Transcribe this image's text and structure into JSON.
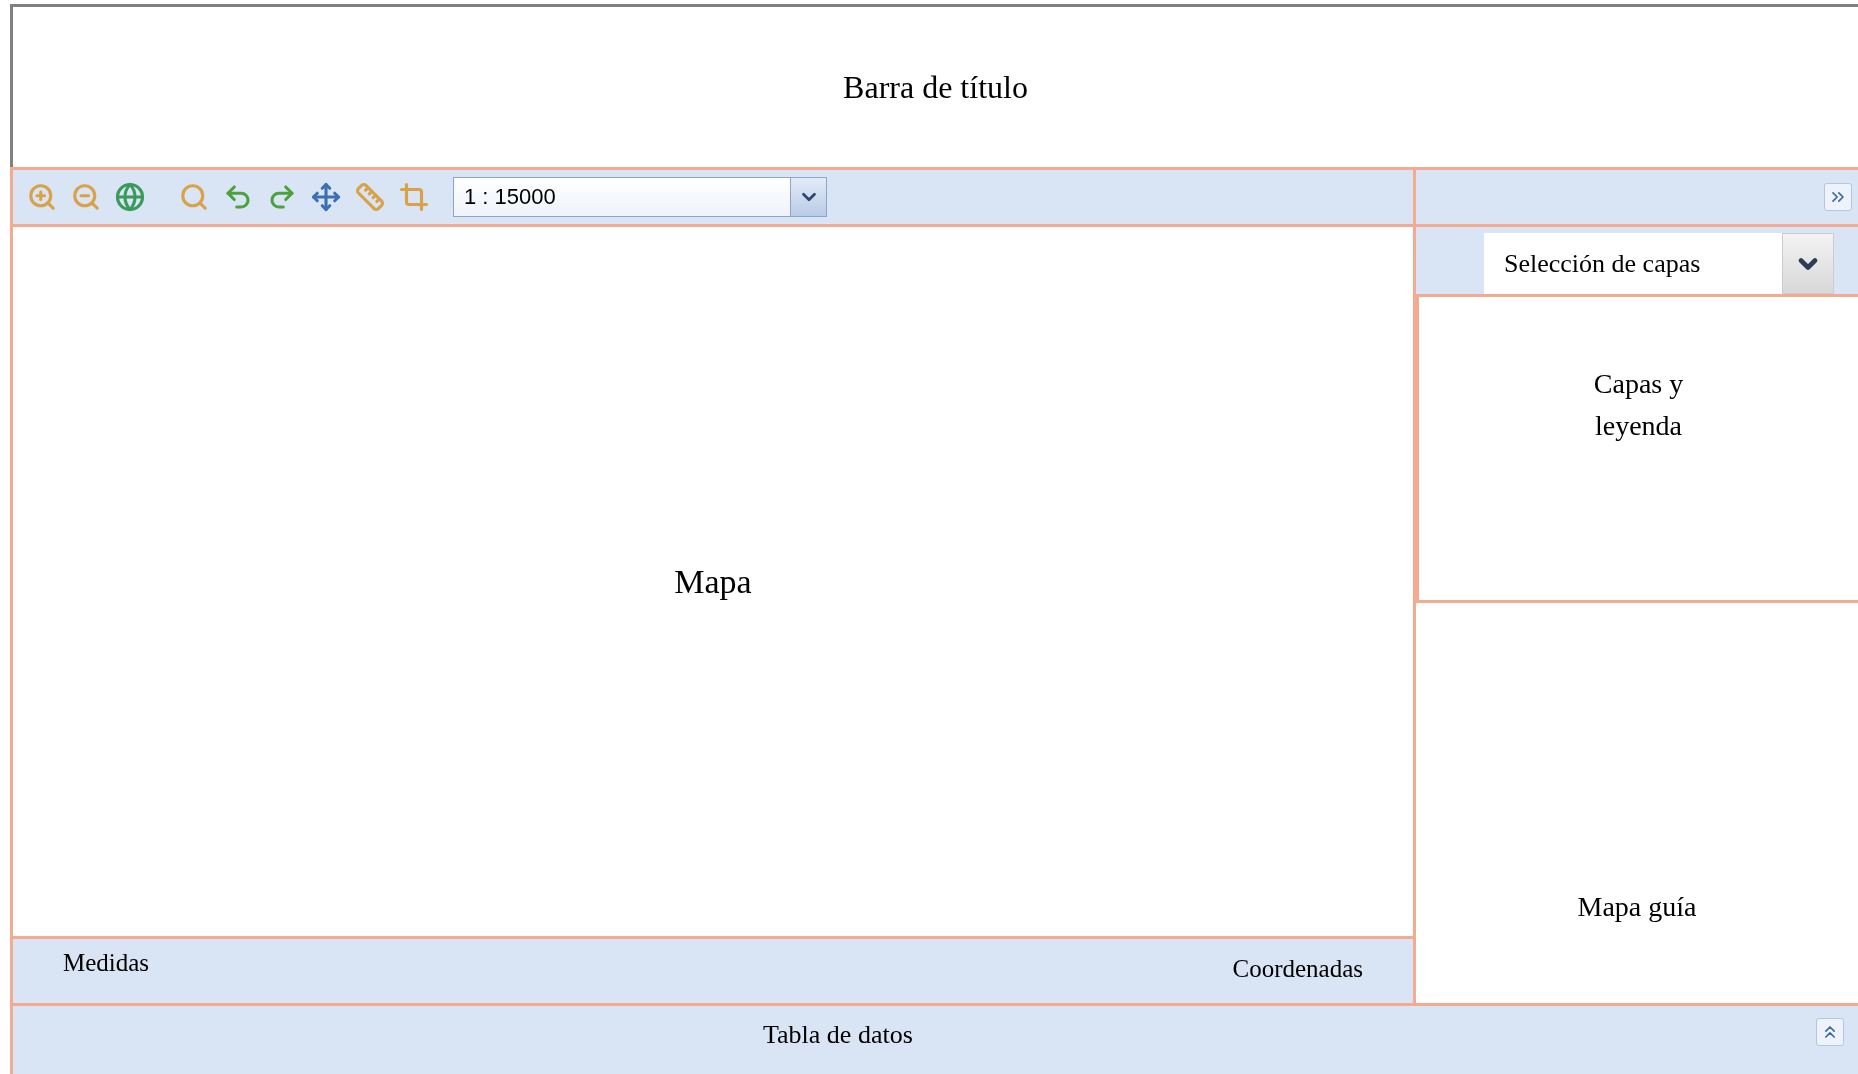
{
  "title_bar": {
    "title": "Barra de título"
  },
  "toolbar": {
    "scale": "1 : 15000"
  },
  "map": {
    "label": "Mapa"
  },
  "status_bar": {
    "left": "Medidas",
    "right": "Coordenadas"
  },
  "side_panel": {
    "layer_select": "Selección de capas",
    "layers_legend": "Capas y leyenda",
    "overview_map": "Mapa guía"
  },
  "data_table": {
    "label": "Tabla de datos"
  }
}
